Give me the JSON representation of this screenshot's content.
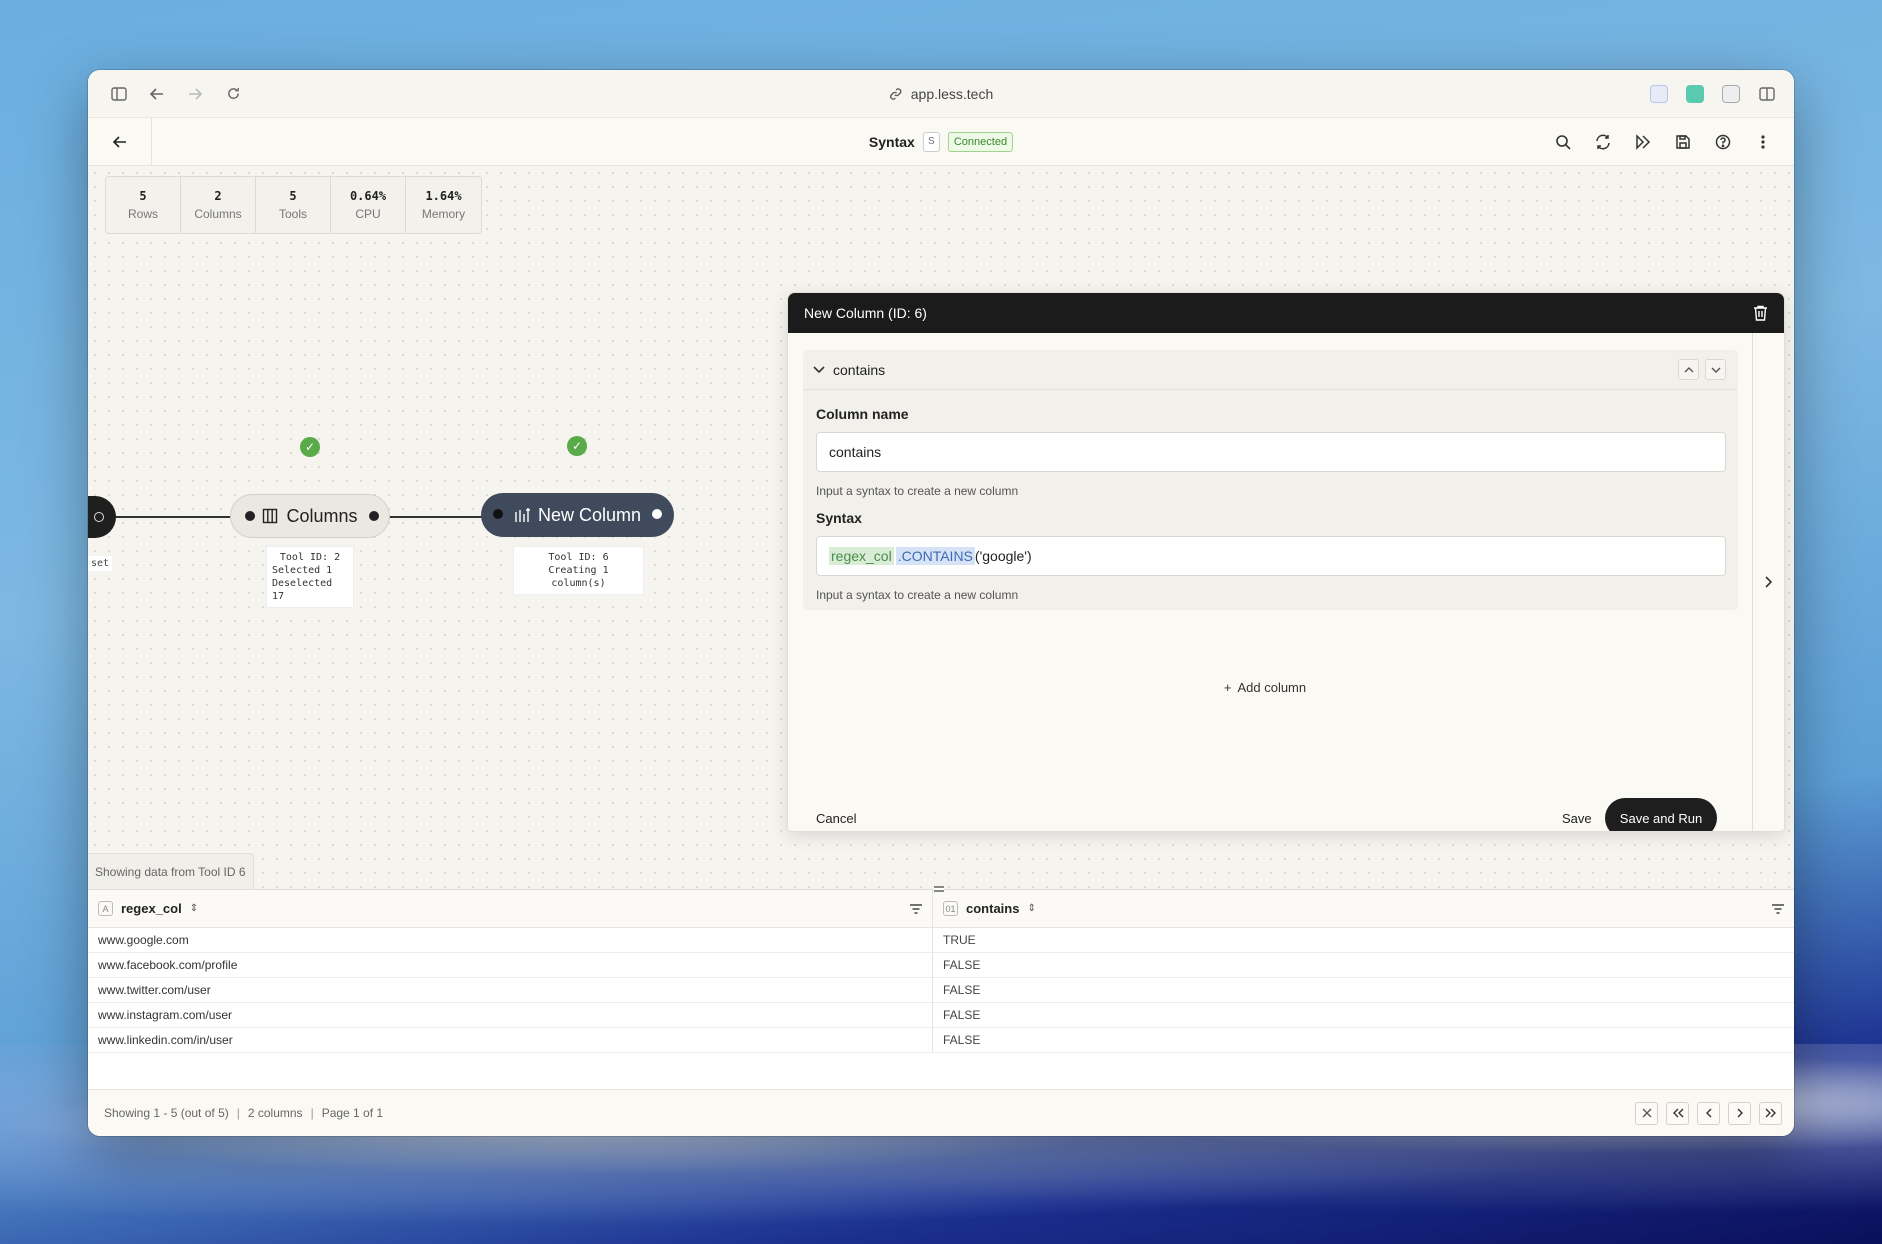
{
  "browser": {
    "url": "app.less.tech"
  },
  "header": {
    "title": "Syntax",
    "badge": "S",
    "status": "Connected"
  },
  "stats": [
    {
      "value": "5",
      "label": "Rows"
    },
    {
      "value": "2",
      "label": "Columns"
    },
    {
      "value": "5",
      "label": "Tools"
    },
    {
      "value": "0.64%",
      "label": "CPU"
    },
    {
      "value": "1.64%",
      "label": "Memory"
    }
  ],
  "nodes": {
    "left_label": "set",
    "columns": {
      "label": "Columns",
      "info": [
        "Tool ID: 2",
        "Selected 1",
        "Deselected 17"
      ]
    },
    "new_column": {
      "label": "New Column",
      "info": [
        "Tool ID: 6",
        "Creating 1 column(s)"
      ]
    }
  },
  "canvas": {
    "showing_data": "Showing data from Tool ID 6"
  },
  "panel": {
    "title": "New Column (ID: 6)",
    "card_title": "contains",
    "column_name_label": "Column name",
    "column_name_value": "contains",
    "column_name_help": "Input a syntax to create a new column",
    "syntax_label": "Syntax",
    "syntax_col": "regex_col",
    "syntax_fn": ".CONTAINS",
    "syntax_rest": "('google')",
    "syntax_help": "Input a syntax to create a new column",
    "add_column": "Add column",
    "cancel": "Cancel",
    "save": "Save",
    "save_and_run": "Save and Run"
  },
  "grid": {
    "columns": [
      {
        "name": "regex_col",
        "type_icon": "A"
      },
      {
        "name": "contains",
        "type_icon": "01"
      }
    ],
    "rows": [
      [
        "www.google.com",
        "TRUE"
      ],
      [
        "www.facebook.com/profile",
        "FALSE"
      ],
      [
        "www.twitter.com/user",
        "FALSE"
      ],
      [
        "www.instagram.com/user",
        "FALSE"
      ],
      [
        "www.linkedin.com/in/user",
        "FALSE"
      ]
    ]
  },
  "footer": {
    "showing": "Showing 1 - 5 (out of 5)",
    "columns": "2 columns",
    "page": "Page 1 of 1"
  }
}
